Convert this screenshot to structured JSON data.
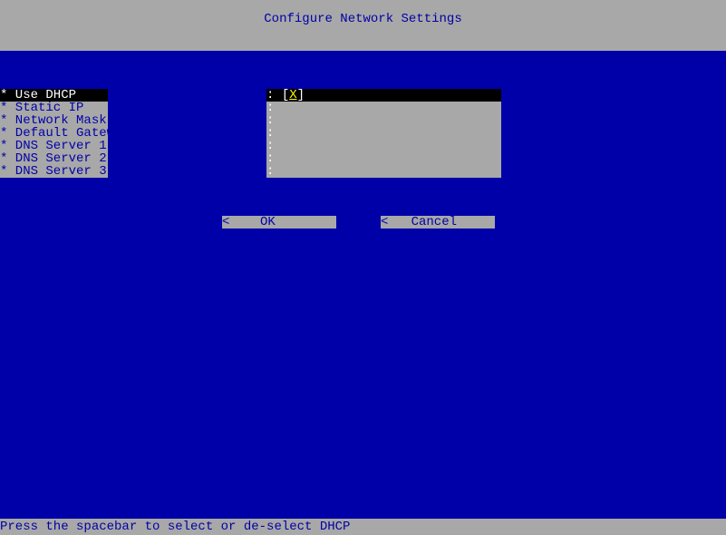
{
  "title": "Configure Network Settings",
  "fields": {
    "use_dhcp": {
      "label": "* Use DHCP",
      "value": "[X]",
      "selected": true
    },
    "static_ip": {
      "label": "* Static IP",
      "value": "",
      "selected": false
    },
    "network_mask": {
      "label": "* Network Mask",
      "value": "",
      "selected": false
    },
    "default_gateway": {
      "label": "* Default Gateway",
      "value": "",
      "selected": false
    },
    "dns1": {
      "label": "* DNS Server 1",
      "value": "",
      "selected": false
    },
    "dns2": {
      "label": "* DNS Server 2",
      "value": "",
      "selected": false
    },
    "dns3": {
      "label": "* DNS Server 3",
      "value": "",
      "selected": false
    }
  },
  "buttons": {
    "ok": "<    OK          >",
    "cancel": "<   Cancel       >"
  },
  "status": "Press the spacebar to select or de-select DHCP"
}
